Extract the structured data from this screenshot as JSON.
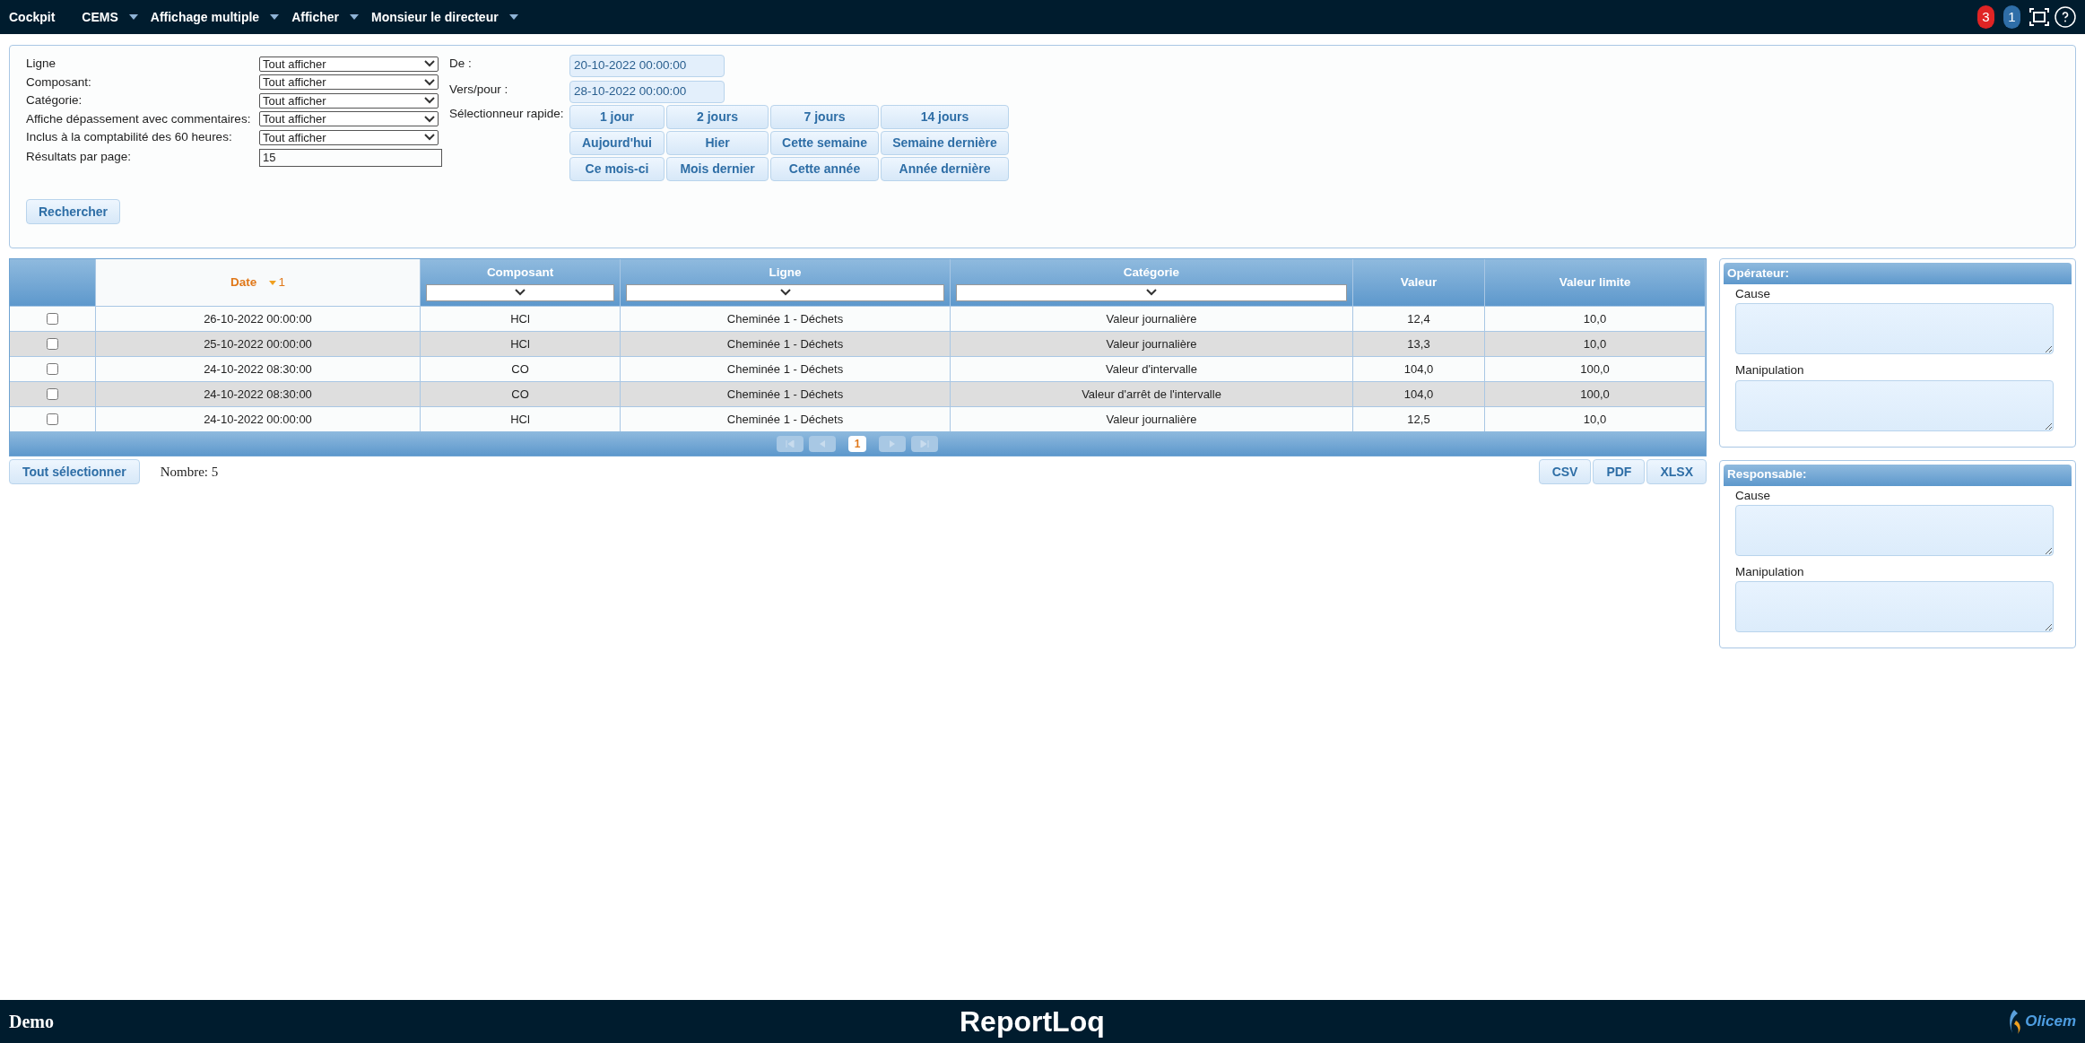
{
  "nav": {
    "items": [
      {
        "label": "Cockpit",
        "dropdown": false
      },
      {
        "label": "CEMS",
        "dropdown": true
      },
      {
        "label": "Affichage multiple",
        "dropdown": true
      },
      {
        "label": "Afficher",
        "dropdown": true
      },
      {
        "label": "Monsieur le directeur",
        "dropdown": true
      }
    ],
    "badges": [
      {
        "label": "3",
        "color": "#e02424"
      },
      {
        "label": "1",
        "color": "#2f6ea8"
      }
    ]
  },
  "filters": {
    "selects": [
      {
        "label": "Ligne",
        "value": "Tout afficher"
      },
      {
        "label": "Composant:",
        "value": "Tout afficher"
      },
      {
        "label": "Catégorie:",
        "value": "Tout afficher"
      },
      {
        "label": "Affiche dépassement avec commentaires:",
        "value": "Tout afficher"
      },
      {
        "label": "Inclus à la comptabilité des 60 heures:",
        "value": "Tout afficher"
      }
    ],
    "per_page": {
      "label": "Résultats par page:",
      "value": "15"
    },
    "from": {
      "label": "De :",
      "value": "20-10-2022 00:00:00"
    },
    "to": {
      "label": "Vers/pour :",
      "value": "28-10-2022 00:00:00"
    },
    "quick": {
      "label": "Sélectionneur rapide:",
      "buttons": [
        "1 jour",
        "2 jours",
        "7 jours",
        "14 jours",
        "Aujourd'hui",
        "Hier",
        "Cette semaine",
        "Semaine dernière",
        "Ce mois-ci",
        "Mois dernier",
        "Cette année",
        "Année dernière"
      ]
    },
    "search_button": "Rechercher"
  },
  "table": {
    "columns": [
      {
        "label": "Date",
        "sorted": true,
        "sort_index": "1",
        "filter": false
      },
      {
        "label": "Composant",
        "sorted": false,
        "filter": true
      },
      {
        "label": "Ligne",
        "sorted": false,
        "filter": true
      },
      {
        "label": "Catégorie",
        "sorted": false,
        "filter": true
      },
      {
        "label": "Valeur",
        "sorted": false,
        "filter": false
      },
      {
        "label": "Valeur limite",
        "sorted": false,
        "filter": false
      }
    ],
    "rows": [
      {
        "checked": false,
        "cells": [
          "26-10-2022 00:00:00",
          "HCl",
          "Cheminée 1 - Déchets",
          "Valeur journalière",
          "12,4",
          "10,0"
        ]
      },
      {
        "checked": false,
        "cells": [
          "25-10-2022 00:00:00",
          "HCl",
          "Cheminée 1 - Déchets",
          "Valeur journalière",
          "13,3",
          "10,0"
        ]
      },
      {
        "checked": false,
        "cells": [
          "24-10-2022 08:30:00",
          "CO",
          "Cheminée 1 - Déchets",
          "Valeur d'intervalle",
          "104,0",
          "100,0"
        ]
      },
      {
        "checked": false,
        "cells": [
          "24-10-2022 08:30:00",
          "CO",
          "Cheminée 1 - Déchets",
          "Valeur d'arrêt de l'intervalle",
          "104,0",
          "100,0"
        ]
      },
      {
        "checked": false,
        "cells": [
          "24-10-2022 00:00:00",
          "HCl",
          "Cheminée 1 - Déchets",
          "Valeur journalière",
          "12,5",
          "10,0"
        ]
      }
    ],
    "pages": [
      {
        "label": "1",
        "selected": true
      }
    ]
  },
  "select_all": "Tout sélectionner",
  "count": "Nombre: 5",
  "exports": [
    "CSV",
    "PDF",
    "XLSX"
  ],
  "side_panels": [
    {
      "title": "Opérateur:",
      "fields": [
        "Cause",
        "Manipulation"
      ]
    },
    {
      "title": "Responsable:",
      "fields": [
        "Cause",
        "Manipulation"
      ]
    }
  ],
  "footer": {
    "left": "Demo",
    "title": "ReportLoq",
    "logo": "Olicem"
  }
}
